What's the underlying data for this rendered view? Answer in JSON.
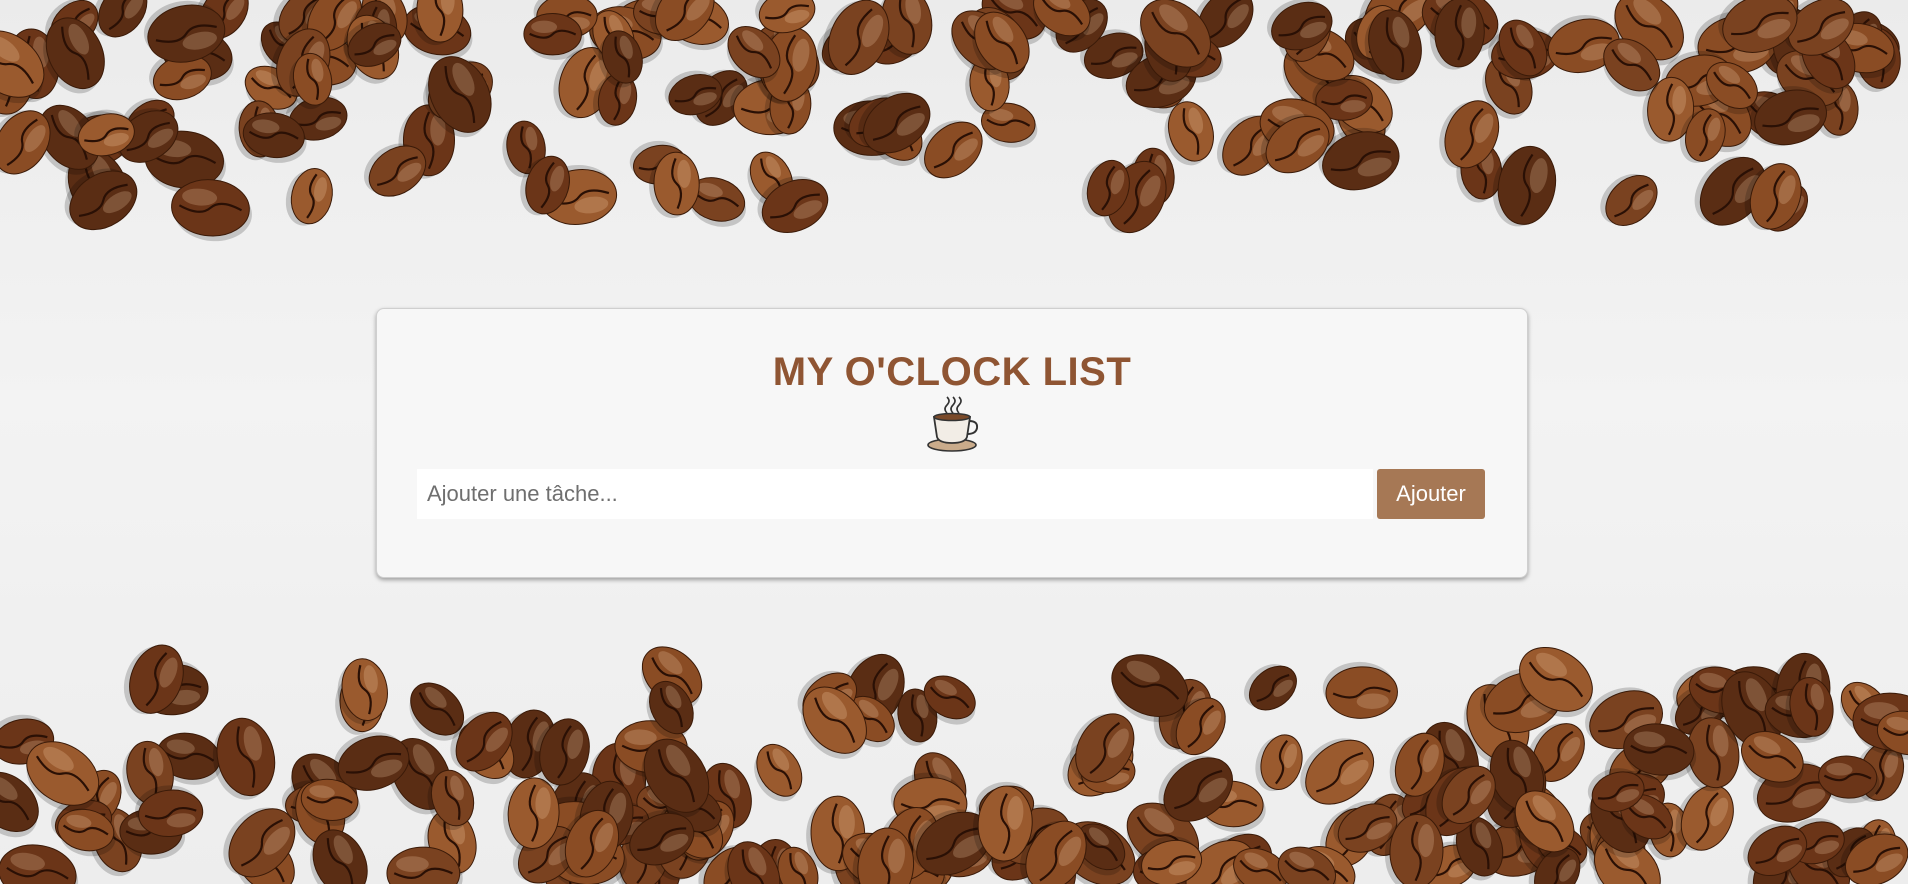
{
  "app": {
    "title": "MY O'CLOCK LIST"
  },
  "form": {
    "task_placeholder": "Ajouter une tâche...",
    "task_value": "",
    "add_label": "Ajouter"
  },
  "icons": {
    "title_icon": "coffee-cup-icon"
  },
  "colors": {
    "title": "#8f5533",
    "button": "#a67855",
    "card": "#f7f7f7",
    "bean_dark": "#5a2d14",
    "bean_mid": "#7a4220",
    "bean_light": "#9a5a2e"
  }
}
